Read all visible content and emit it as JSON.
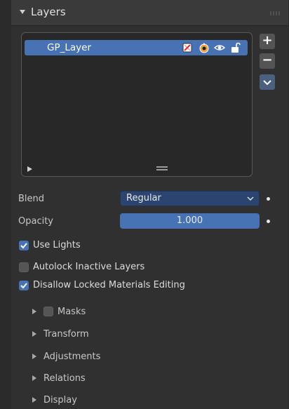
{
  "panel": {
    "title": "Layers"
  },
  "layer_list": {
    "items": [
      {
        "name": "GP_Layer",
        "icons": [
          "mask-disabled-icon",
          "onion-skin-icon",
          "eye-icon",
          "lock-open-icon"
        ]
      }
    ]
  },
  "side_buttons": {
    "add": "+",
    "remove": "−"
  },
  "properties": {
    "blend_label": "Blend",
    "blend_value": "Regular",
    "opacity_label": "Opacity",
    "opacity_value": "1.000",
    "opacity_fraction": 1.0
  },
  "options": {
    "use_lights": {
      "label": "Use Lights",
      "checked": true
    },
    "autolock": {
      "label": "Autolock Inactive Layers",
      "checked": false
    },
    "disallow_locked": {
      "label": "Disallow Locked Materials Editing",
      "checked": true
    }
  },
  "subpanels": {
    "masks": "Masks",
    "transform": "Transform",
    "adjustments": "Adjustments",
    "relations": "Relations",
    "display": "Display"
  },
  "colors": {
    "accent": "#4772b3",
    "panel_bg": "#303030",
    "list_bg": "#282828"
  }
}
